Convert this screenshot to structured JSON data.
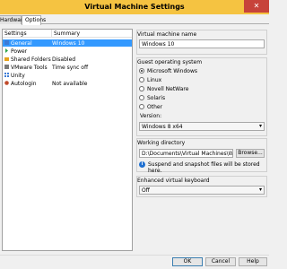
{
  "window": {
    "title": "Virtual Machine Settings",
    "close_glyph": "✕"
  },
  "tabs": [
    {
      "label": "Hardware"
    },
    {
      "label": "Options"
    }
  ],
  "settings": {
    "headers": {
      "settings": "Settings",
      "summary": "Summary"
    },
    "items": [
      {
        "name": "General",
        "summary": "Windows 10",
        "icon": "general-icon",
        "color": "#3b7bd6"
      },
      {
        "name": "Power",
        "summary": "",
        "icon": "power-icon",
        "color": "#2aa346"
      },
      {
        "name": "Shared Folders",
        "summary": "Disabled",
        "icon": "shared-folders-icon",
        "color": "#e6a21b"
      },
      {
        "name": "VMware Tools",
        "summary": "Time sync off",
        "icon": "vmware-tools-icon",
        "color": "#7a7a7a"
      },
      {
        "name": "Unity",
        "summary": "",
        "icon": "unity-icon",
        "color": "#3b7bd6"
      },
      {
        "name": "Autologin",
        "summary": "Not available",
        "icon": "autologin-icon",
        "color": "#c04a2a"
      }
    ]
  },
  "vm_name": {
    "label": "Virtual machine name",
    "value": "Windows 10"
  },
  "guest_os": {
    "label": "Guest operating system",
    "options": [
      {
        "label": "Microsoft Windows",
        "selected": true
      },
      {
        "label": "Linux",
        "selected": false
      },
      {
        "label": "Novell NetWare",
        "selected": false
      },
      {
        "label": "Solaris",
        "selected": false
      },
      {
        "label": "Other",
        "selected": false
      }
    ],
    "version_label": "Version:",
    "version_value": "Windows 8 x64"
  },
  "working_dir": {
    "label": "Working directory",
    "value": "D:\\Documents\\Virtual Machines\\Windows",
    "browse": "Browse...",
    "note": "Suspend and snapshot files will be stored here."
  },
  "keyboard": {
    "label": "Enhanced virtual keyboard",
    "value": "Off"
  },
  "buttons": {
    "ok": "OK",
    "cancel": "Cancel",
    "help": "Help"
  }
}
